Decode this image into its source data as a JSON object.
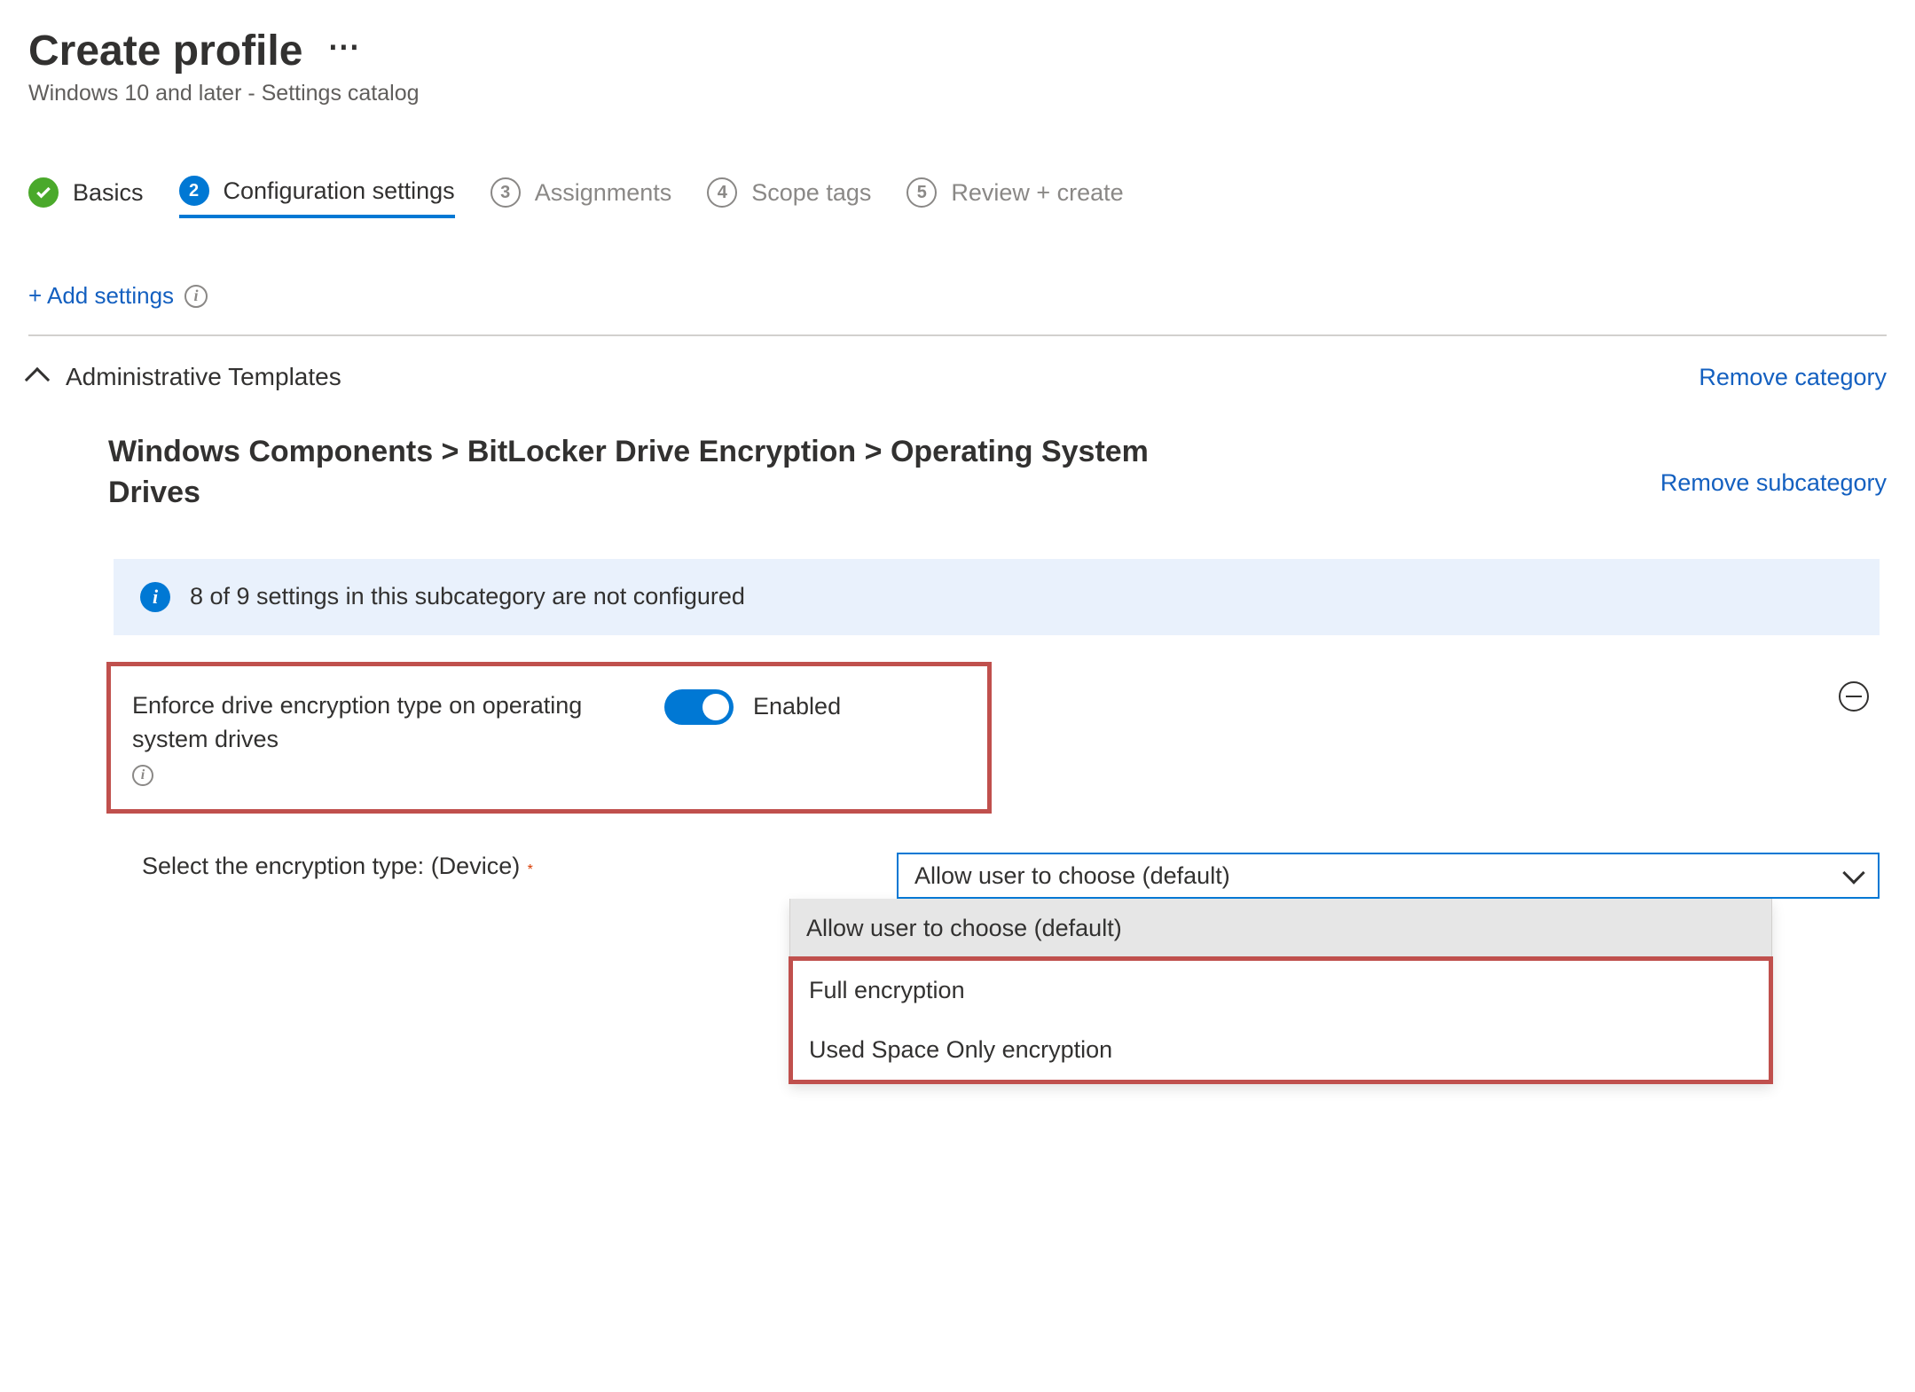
{
  "header": {
    "title": "Create profile",
    "subtitle": "Windows 10 and later - Settings catalog"
  },
  "stepper": [
    {
      "num": "",
      "label": "Basics",
      "state": "done"
    },
    {
      "num": "2",
      "label": "Configuration settings",
      "state": "active"
    },
    {
      "num": "3",
      "label": "Assignments",
      "state": "pending"
    },
    {
      "num": "4",
      "label": "Scope tags",
      "state": "pending"
    },
    {
      "num": "5",
      "label": "Review + create",
      "state": "pending"
    }
  ],
  "addSettingsLabel": "+ Add settings",
  "category": {
    "name": "Administrative Templates",
    "removeLabel": "Remove category"
  },
  "subcategory": {
    "breadcrumb": "Windows Components > BitLocker Drive Encryption > Operating System Drives",
    "removeLabel": "Remove subcategory"
  },
  "infoMessage": "8 of 9 settings in this subcategory are not configured",
  "setting": {
    "label": "Enforce drive encryption type on operating system drives",
    "toggleState": "Enabled"
  },
  "field": {
    "label": "Select the encryption type: (Device)",
    "required": "*",
    "selected": "Allow user to choose (default)",
    "options": [
      "Allow user to choose (default)",
      "Full encryption",
      "Used Space Only encryption"
    ]
  }
}
